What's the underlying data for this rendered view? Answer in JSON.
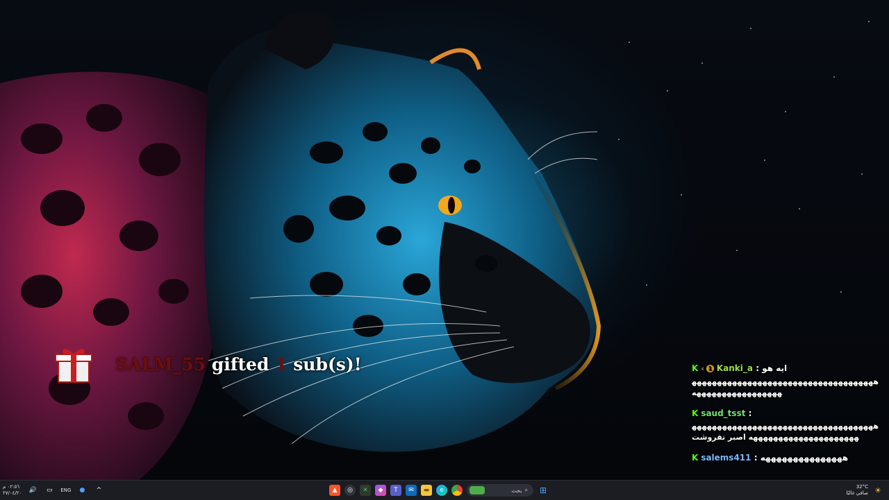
{
  "alert": {
    "username": "SALM_55",
    "gifted": "gifted",
    "count": "1",
    "subs": "sub(s)!"
  },
  "chat": {
    "messages": [
      {
        "username": "Kanki_a",
        "separator": ":",
        "text": "ايه هو"
      },
      {
        "text": "ههههههههههههههههههههههههههههههههههههههههههههههههههههههه"
      },
      {
        "username": "saud_tsst",
        "separator": ":",
        "text": "ههههههههههههههههههههههههههههههههههههههههههههههههههههههههههه اصبر تفروشت"
      },
      {
        "username": "salems411",
        "separator": ":",
        "text": "هههههههههههههههه"
      }
    ]
  },
  "taskbar": {
    "clock_time": "٠٢:٥٦ م",
    "clock_date": "٢٧/٠٤/٢٠",
    "language": "ENG",
    "search_label": "بحث",
    "weather_temp": "32°C",
    "weather_desc": "صافي غالبًا",
    "icons": [
      "brave-icon",
      "obs-icon",
      "xbox-icon",
      "copilot-icon",
      "teams-icon",
      "mail-icon",
      "file-explorer-icon",
      "edge-icon",
      "chrome-icon",
      "car-game-icon",
      "start-icon"
    ]
  },
  "colors": {
    "kick_green": "#53fc18",
    "alert_red": "#6a0f0f",
    "taskbar_bg": "#1b1d22"
  }
}
